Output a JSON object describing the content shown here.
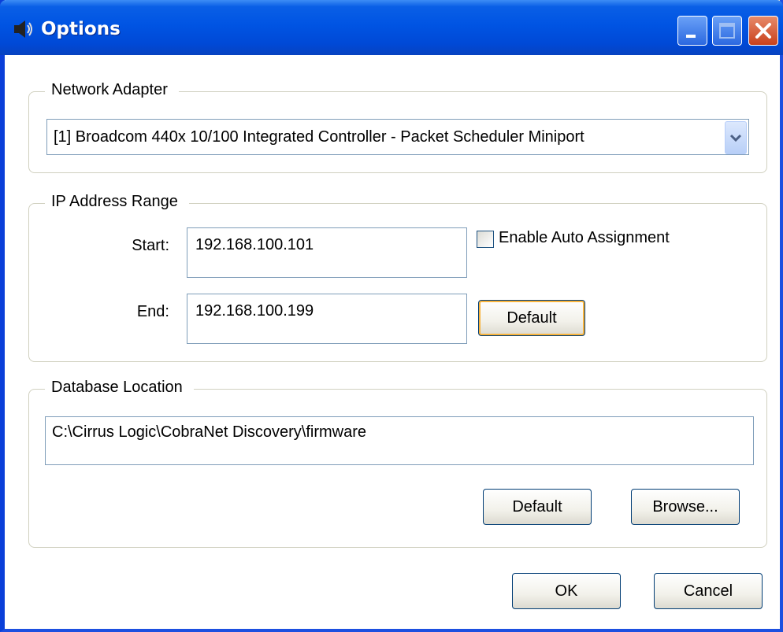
{
  "window": {
    "title": "Options",
    "title_icon": "speaker-icon",
    "controls": [
      "minimize-icon",
      "maximize-icon",
      "close-icon"
    ]
  },
  "network_adapter": {
    "legend": "Network Adapter",
    "selected": "[1] Broadcom 440x 10/100 Integrated Controller - Packet Scheduler Miniport",
    "dropdown_icon": "chevron-down-icon"
  },
  "ip_range": {
    "legend": "IP Address Range",
    "start_label": "Start:",
    "start_value": "192.168.100.101",
    "end_label": "End:",
    "end_value": "192.168.100.199",
    "auto_assign_label": "Enable Auto Assignment",
    "auto_assign_checked": false,
    "default_button": "Default"
  },
  "database": {
    "legend": "Database Location",
    "path": "C:\\Cirrus Logic\\CobraNet Discovery\\firmware",
    "default_button": "Default",
    "browse_button": "Browse..."
  },
  "dialog_buttons": {
    "ok": "OK",
    "cancel": "Cancel"
  },
  "colors": {
    "titlebar": "#0054e3",
    "close": "#c9411c",
    "focus": "#f8b33c"
  }
}
